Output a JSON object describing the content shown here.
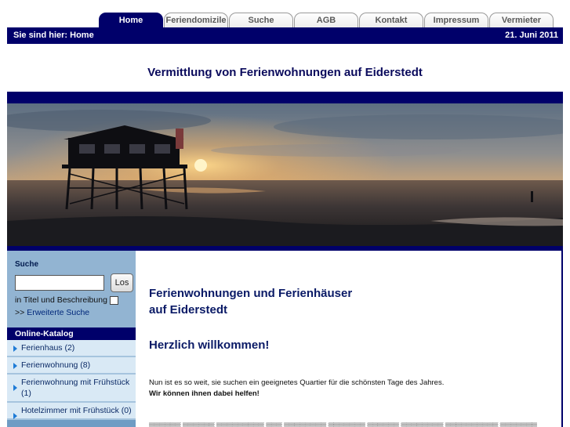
{
  "nav": {
    "tabs": [
      {
        "label": "Home",
        "active": true
      },
      {
        "label": "Feriendomizile",
        "active": false
      },
      {
        "label": "Suche",
        "active": false
      },
      {
        "label": "AGB",
        "active": false
      },
      {
        "label": "Kontakt",
        "active": false
      },
      {
        "label": "Impressum",
        "active": false
      },
      {
        "label": "Vermieter",
        "active": false
      }
    ]
  },
  "breadcrumb": "Sie sind hier: Home",
  "date": "21. Juni 2011",
  "site_title": "Vermittlung von Ferienwohnungen auf Eiderstedt",
  "sidebar": {
    "search": {
      "title": "Suche",
      "input_value": "",
      "button": "Los",
      "option_label": "in Titel und Beschreibung",
      "advanced_prefix": ">>",
      "advanced_link": "Erweiterte Suche"
    },
    "catalog": {
      "title": "Online-Katalog",
      "items": [
        {
          "label": "Ferienhaus (2)"
        },
        {
          "label": "Ferienwohnung (8)"
        },
        {
          "label": "Ferienwohnung mit Frühstück (1)"
        },
        {
          "label": "Hotelzimmer mit Frühstück (0)"
        }
      ]
    }
  },
  "main": {
    "heading_line1": "Ferienwohnungen und Ferienhäuser",
    "heading_line2": "auf Eiderstedt",
    "welcome": "Herzlich willkommen!",
    "intro": "Nun ist es so weit, sie suchen ein geeignetes Quartier für die schönsten Tage des Jahres.",
    "intro_bold": "Wir können ihnen dabei helfen!"
  },
  "colors": {
    "navy": "#00006a",
    "sidebar_blue": "#92b4d2",
    "catalog_item_bg": "#d9e9f5"
  }
}
